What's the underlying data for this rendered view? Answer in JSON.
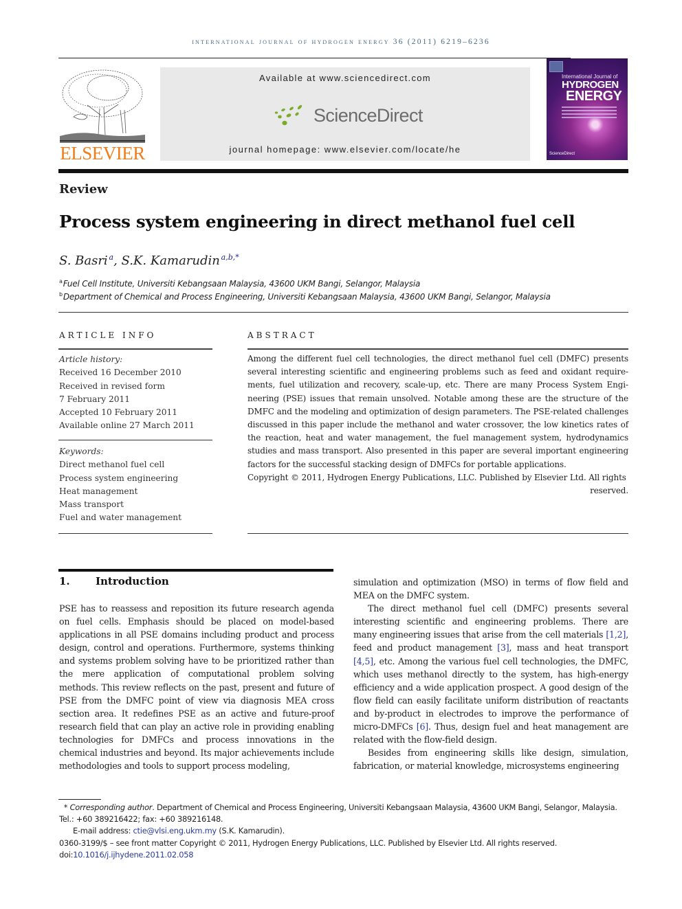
{
  "running_head": "INTERNATIONAL JOURNAL OF HYDROGEN ENERGY 36 (2011) 6219–6236",
  "publisher": {
    "logo_text": "ELSEVIER",
    "logo_color": "#f07d1c"
  },
  "banner": {
    "available_at": "Available at www.sciencedirect.com",
    "brand": "ScienceDirect",
    "brand_dot_color": "#7aab2a",
    "homepage": "journal homepage: www.elsevier.com/locate/he"
  },
  "cover": {
    "line1": "International Journal of",
    "line2": "HYDROGEN",
    "line3": "ENERGY",
    "footer": "ScienceDirect"
  },
  "article": {
    "type": "Review",
    "title": "Process system engineering in direct methanol fuel cell",
    "authors": [
      {
        "name": "S. Basri",
        "marks": "a"
      },
      {
        "name": "S.K. Kamarudin",
        "marks": "a,b,*"
      }
    ],
    "affiliations": [
      {
        "mark": "a",
        "text": "Fuel Cell Institute, Universiti Kebangsaan Malaysia, 43600 UKM Bangi, Selangor, Malaysia"
      },
      {
        "mark": "b",
        "text": "Department of Chemical and Process Engineering, Universiti Kebangsaan Malaysia, 43600 UKM Bangi, Selangor, Malaysia"
      }
    ]
  },
  "article_info": {
    "heading": "ARTICLE INFO",
    "history_label": "Article history:",
    "history": [
      "Received 16 December 2010",
      "Received in revised form",
      "7 February 2011",
      "Accepted 10 February 2011",
      "Available online 27 March 2011"
    ],
    "keywords_label": "Keywords:",
    "keywords": [
      "Direct methanol fuel cell",
      "Process system engineering",
      "Heat management",
      "Mass transport",
      "Fuel and water management"
    ]
  },
  "abstract": {
    "heading": "ABSTRACT",
    "text": "Among the different fuel cell technologies, the direct methanol fuel cell (DMFC) presents several interesting scientific and engineering problems such as feed and oxidant require­ments, fuel utilization and recovery, scale-up, etc. There are many Process System Engi­neering (PSE) issues that remain unsolved. Notable among these are the structure of the DMFC and the modeling and optimization of design parameters. The PSE-related chal­lenges discussed in this paper include the methanol and water crossover, the low kinetics rates of the reaction, heat and water management, the fuel management system, hydro­dynamics studies and mass transport. Also presented in this paper are several important engineering factors for the successful stacking design of DMFCs for portable applications.",
    "copyright": "Copyright © 2011, Hydrogen Energy Publications, LLC. Published by Elsevier Ltd. All rights",
    "reserved": "reserved."
  },
  "introduction": {
    "number": "1.",
    "heading": "Introduction",
    "left_para": "PSE has to reassess and reposition its future research agenda on fuel cells. Emphasis should be placed on model-based applications in all PSE domains including product and process design, control and operations. Furthermore, systems thinking and systems problem solving have to be prioritized rather than the mere application of computational problem solving methods. This review reflects on the past, present and future of PSE from the DMFC point of view via diagnosis MEA cross section area. It redefines PSE as an active and future-proof research field that can play an active role in providing enabling technologies for DMFCs and process innovations in the chemical industries and beyond. Its major achievements include methodologies and tools to support process modeling,",
    "right_cont": "simulation and optimization (MSO) in terms of flow field and MEA on the DMFC system.",
    "right_p2": {
      "t1": "The direct methanol fuel cell (DMFC) presents several interesting scientific and engineering problems. There are many engineering issues that arise from the cell materials ",
      "r1": "[1,2]",
      "t2": ", feed and product management ",
      "r2": "[3]",
      "t3": ", mass and heat transport ",
      "r3": "[4,5]",
      "t4": ", etc. Among the various fuel cell technologies, the DMFC, which uses methanol directly to the system, has high-energy efficiency and a wide application prospect. A good design of the flow field can easily facilitate uniform distribu­tion of reactants and by-product in electrodes to improve the performance of micro-DMFCs ",
      "r4": "[6]",
      "t5": ". Thus, design fuel and heat management are related with the flow-field design."
    },
    "right_p3": "Besides from engineering skills like design, simulation, fabrication, or material knowledge, microsystems engineering"
  },
  "footnotes": {
    "star": "*",
    "corr_label": "Corresponding author",
    "corr_text": ". Department of Chemical and Process Engineering, Universiti Kebangsaan Malaysia, 43600 UKM Bangi, Selangor, Malaysia. Tel.: +60 389216422; fax: +60 389216148.",
    "email_label": "E-mail address: ",
    "email": "ctie@vlsi.eng.ukm.my",
    "email_suffix": " (S.K. Kamarudin).",
    "issn_line": "0360-3199/$ – see front matter Copyright © 2011, Hydrogen Energy Publications, LLC. Published by Elsevier Ltd. All rights reserved.",
    "doi_label": "doi:",
    "doi": "10.1016/j.ijhydene.2011.02.058"
  }
}
